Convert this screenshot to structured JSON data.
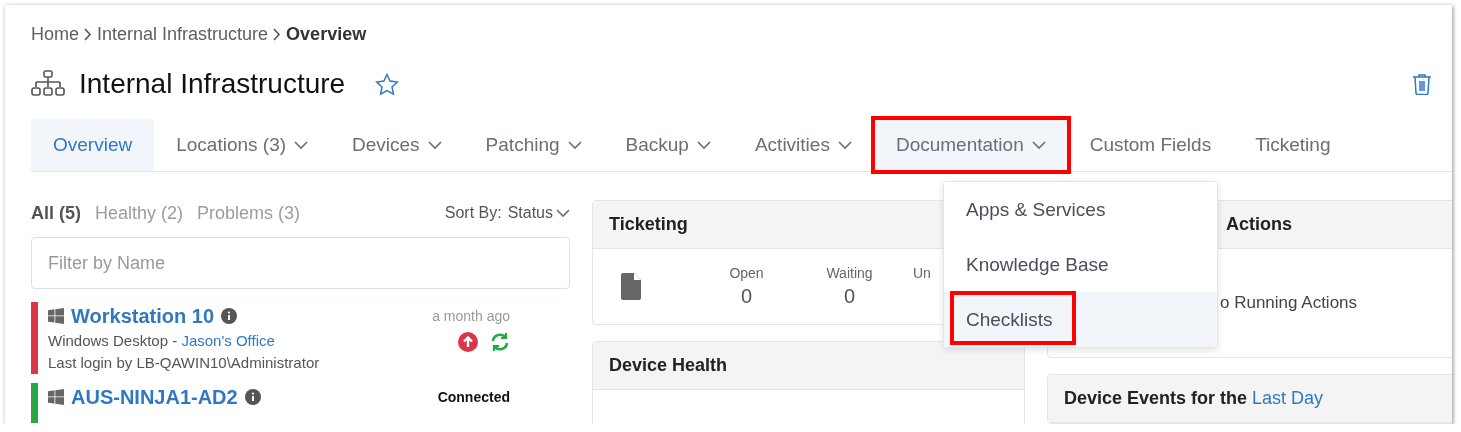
{
  "breadcrumb": [
    {
      "label": "Home",
      "current": false
    },
    {
      "label": "Internal Infrastructure",
      "current": false
    },
    {
      "label": "Overview",
      "current": true
    }
  ],
  "title": "Internal Infrastructure",
  "favorite": false,
  "tabs": [
    {
      "label": "Overview",
      "selected": true,
      "dropdown": false,
      "highlighted": false
    },
    {
      "label": "Locations (3)",
      "selected": false,
      "dropdown": true,
      "highlighted": false
    },
    {
      "label": "Devices",
      "selected": false,
      "dropdown": true,
      "highlighted": false
    },
    {
      "label": "Patching",
      "selected": false,
      "dropdown": true,
      "highlighted": false
    },
    {
      "label": "Backup",
      "selected": false,
      "dropdown": true,
      "highlighted": false
    },
    {
      "label": "Activities",
      "selected": false,
      "dropdown": true,
      "highlighted": false
    },
    {
      "label": "Documentation",
      "selected": false,
      "dropdown": true,
      "highlighted": true,
      "open": true
    },
    {
      "label": "Custom Fields",
      "selected": false,
      "dropdown": false,
      "highlighted": false
    },
    {
      "label": "Ticketing",
      "selected": false,
      "dropdown": false,
      "highlighted": false
    }
  ],
  "menu": [
    {
      "label": "Apps & Services",
      "hovered": false,
      "highlighted": false
    },
    {
      "label": "Knowledge Base",
      "hovered": false,
      "highlighted": false
    },
    {
      "label": "Checklists",
      "hovered": true,
      "highlighted": true
    }
  ],
  "filters": [
    {
      "label": "All (5)",
      "selected": true
    },
    {
      "label": "Healthy (2)",
      "selected": false
    },
    {
      "label": "Problems (3)",
      "selected": false
    }
  ],
  "sort": {
    "label": "Sort By:",
    "value": "Status"
  },
  "search": {
    "placeholder": "Filter by Name"
  },
  "devices": [
    {
      "name": "Workstation 10",
      "color": "#d9364a",
      "type": "Windows Desktop - ",
      "location": "Jason's Office",
      "login": "Last login by LB-QAWIN10\\Administrator",
      "status": "a month ago",
      "status_bold": false,
      "alerts": true
    },
    {
      "name": "AUS-NINJA1-AD2",
      "color": "#28a745",
      "status": "Connected",
      "status_bold": true,
      "alerts": false
    }
  ],
  "ticketing": {
    "title": "Ticketing",
    "stats": [
      {
        "label": "Open",
        "value": "0"
      },
      {
        "label": "Waiting",
        "value": "0"
      },
      {
        "label": "Un"
      }
    ]
  },
  "device_health": {
    "title": "Device Health"
  },
  "actions": {
    "title": "Actions",
    "message": "o Running Actions"
  },
  "events": {
    "title": "Device Events for the ",
    "link": "Last Day"
  }
}
